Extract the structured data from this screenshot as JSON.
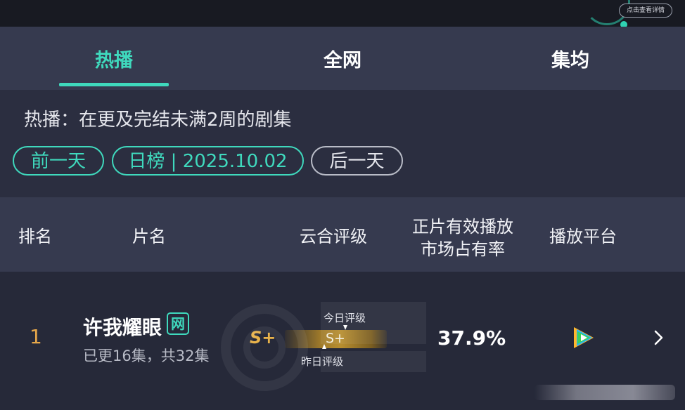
{
  "topbar": {
    "detail_button": "点击查看详情"
  },
  "tabs": [
    {
      "label": "热播",
      "active": true
    },
    {
      "label": "全网",
      "active": false
    },
    {
      "label": "集均",
      "active": false
    }
  ],
  "filter": {
    "description": "热播：在更及完结未满2周的剧集",
    "prev_label": "前一天",
    "date_label": "日榜 | 2025.10.02",
    "next_label": "后一天"
  },
  "table": {
    "headers": {
      "rank": "排名",
      "title": "片名",
      "rating": "云合评级",
      "share_line1": "正片有效播放",
      "share_line2": "市场占有率",
      "platform": "播放平台"
    },
    "rows": [
      {
        "rank": "1",
        "title": "许我耀眼",
        "tag": "网",
        "episodes": "已更16集，共32集",
        "grade": "S+",
        "grade_bar_label": "S+",
        "today_label": "今日评级",
        "yesterday_label": "昨日评级",
        "share": "37.9%",
        "platform_icon": "tencent-video-icon"
      }
    ]
  },
  "colors": {
    "accent": "#3fd9bd",
    "rank": "#e4a64a",
    "grade": "#e8b24a",
    "header_bg": "#363a4f",
    "row_bg": "#262939"
  }
}
